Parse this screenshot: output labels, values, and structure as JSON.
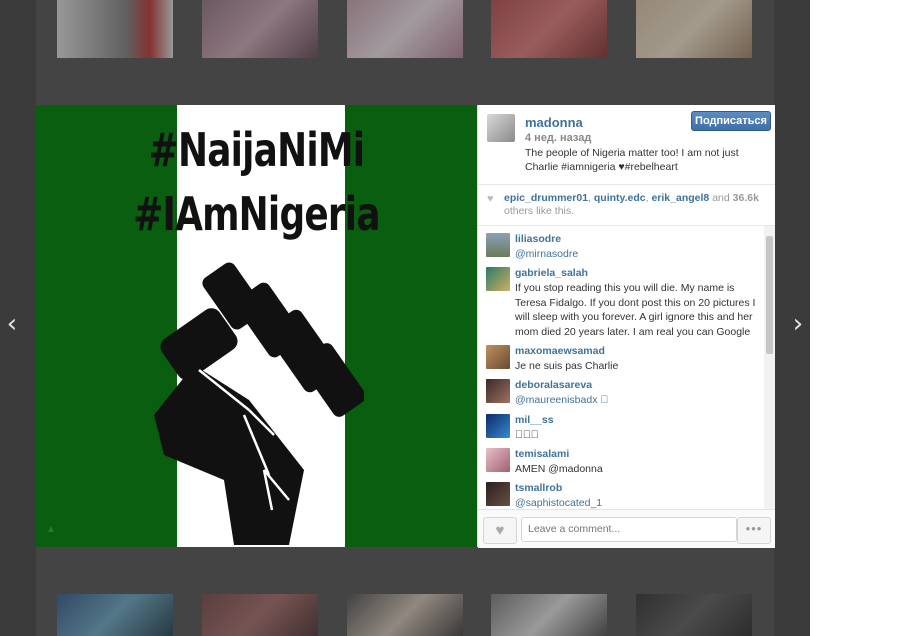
{
  "post": {
    "username": "madonna",
    "follow_label": "Подписаться",
    "time_ago": "4 нед. назад",
    "caption": "The people of Nigeria matter too! I am not just Charlie #iamnigeria ♥#rebelheart",
    "image_text": {
      "line1": "#NaijaNiMi",
      "line2": "#IAmNigeria"
    },
    "likes": {
      "users": [
        "epic_drummer01",
        "quinty.edc",
        "erik_angel8"
      ],
      "and_label": "and",
      "count": "36.6k",
      "suffix": "others like this."
    }
  },
  "comments": [
    {
      "user": "liliasodre",
      "text": "@mirnasodre",
      "link": true
    },
    {
      "user": "gabriela_salah",
      "text": "If you stop reading this you will die. My name is Teresa Fidalgo. If you dont post this on 20 pictures I will sleep with you forever. A girl ignore this and her mom died 20 years later. I am real you can Google",
      "link": false
    },
    {
      "user": "maxomaewsamad",
      "text": "Je ne suis pas Charlie",
      "link": false
    },
    {
      "user": "deboralasareva",
      "text": "@maureenisbadx 󾓧",
      "link": true
    },
    {
      "user": "mil__ss",
      "text": "󾓧󾓧󾓧",
      "link": false
    },
    {
      "user": "temisalami",
      "text": "AMEN @madonna",
      "link": false
    },
    {
      "user": "tsmallrob",
      "text": "@saphistocated_1",
      "link": true
    }
  ],
  "footer": {
    "comment_placeholder": "Leave a comment...",
    "more_label": "•••"
  },
  "icons": {
    "prev": "chevron-left-icon",
    "next": "chevron-right-icon",
    "like": "heart-icon",
    "more": "more-dots-icon"
  },
  "colors": {
    "link": "#3f729b",
    "follow_button": "#4a7eb8",
    "flag_green": "#0a5e0f"
  }
}
